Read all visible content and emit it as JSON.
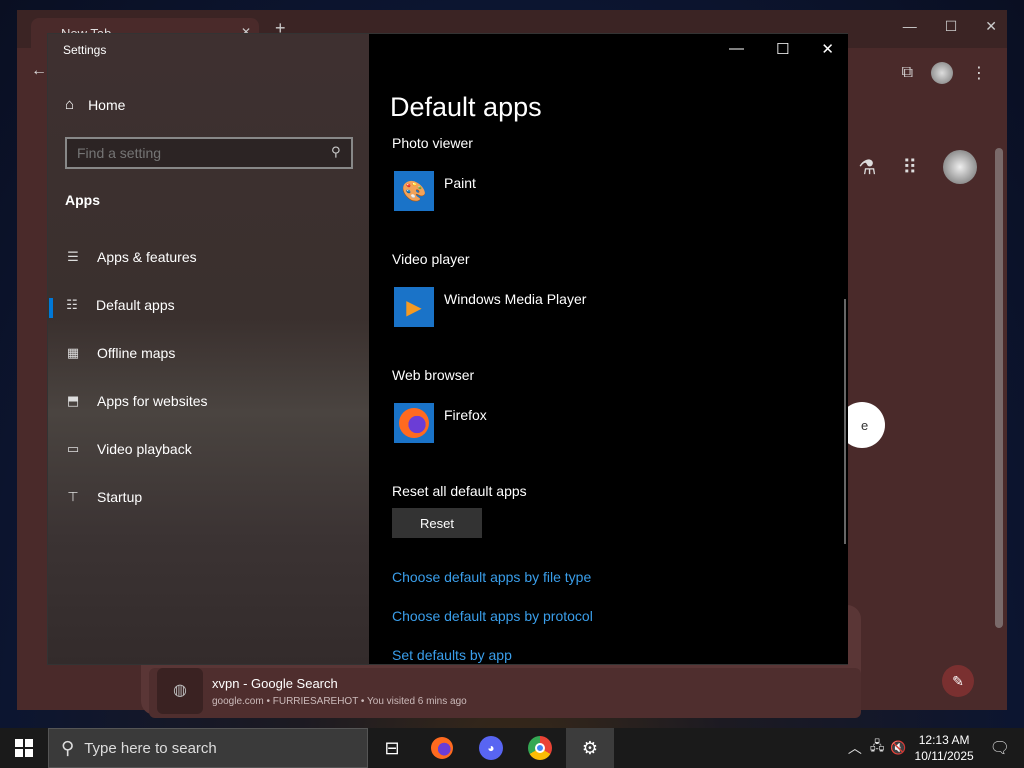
{
  "browser": {
    "tab_title": "New Tab",
    "search_result": {
      "title": "xvpn - Google Search",
      "subtitle": "google.com • FURRIESAREHOT • You visited 6 mins ago"
    }
  },
  "settings": {
    "window_title": "Settings",
    "nav": {
      "home": "Home",
      "search_placeholder": "Find a setting",
      "section": "Apps",
      "items": [
        {
          "label": "Apps & features",
          "icon": "list-icon"
        },
        {
          "label": "Default apps",
          "icon": "default-apps-icon",
          "active": true
        },
        {
          "label": "Offline maps",
          "icon": "map-icon"
        },
        {
          "label": "Apps for websites",
          "icon": "link-box-icon"
        },
        {
          "label": "Video playback",
          "icon": "video-icon"
        },
        {
          "label": "Startup",
          "icon": "startup-icon"
        }
      ]
    },
    "main": {
      "title": "Default apps",
      "photo_viewer": {
        "label": "Photo viewer",
        "app": "Paint"
      },
      "video_player": {
        "label": "Video player",
        "app": "Windows Media Player"
      },
      "web_browser": {
        "label": "Web browser",
        "app": "Firefox"
      },
      "reset": {
        "label": "Reset all default apps",
        "button": "Reset"
      },
      "links": [
        "Choose default apps by file type",
        "Choose default apps by protocol",
        "Set defaults by app"
      ]
    }
  },
  "taskbar": {
    "search_placeholder": "Type here to search",
    "time": "12:13 AM",
    "date": "10/11/2025"
  },
  "colors": {
    "accent": "#0078d7",
    "link": "#3a9eea"
  }
}
